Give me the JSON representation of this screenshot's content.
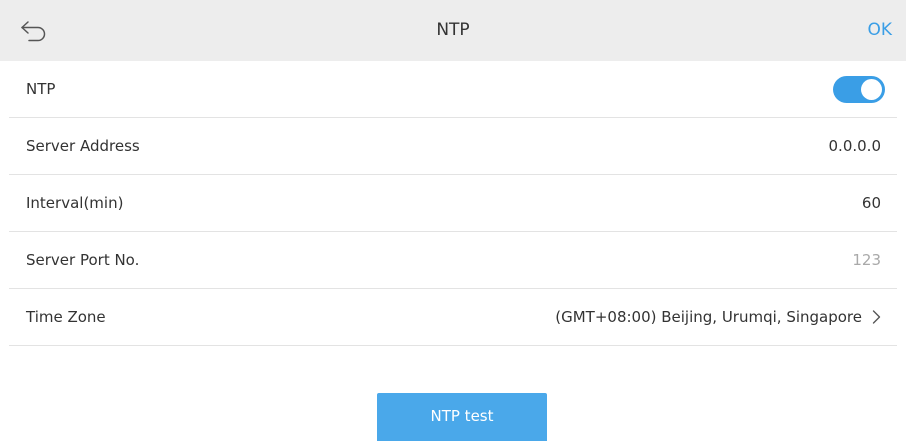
{
  "header": {
    "title": "NTP",
    "ok_label": "OK",
    "back_icon": "back-arrow-icon"
  },
  "rows": [
    {
      "label": "NTP",
      "type": "toggle",
      "enabled": true
    },
    {
      "label": "Server Address",
      "value": "0.0.0.0"
    },
    {
      "label": "Interval(min)",
      "value": "60"
    },
    {
      "label": "Server Port No.",
      "value": "123"
    },
    {
      "label": "Time Zone",
      "value": "(GMT+08:00) Beijing, Urumqi, Singapore"
    }
  ],
  "test_button": {
    "label": "NTP test"
  },
  "colors": {
    "accent": "#3a9ee6",
    "header_bg": "#ededed",
    "muted_text": "#a9a9a9"
  }
}
